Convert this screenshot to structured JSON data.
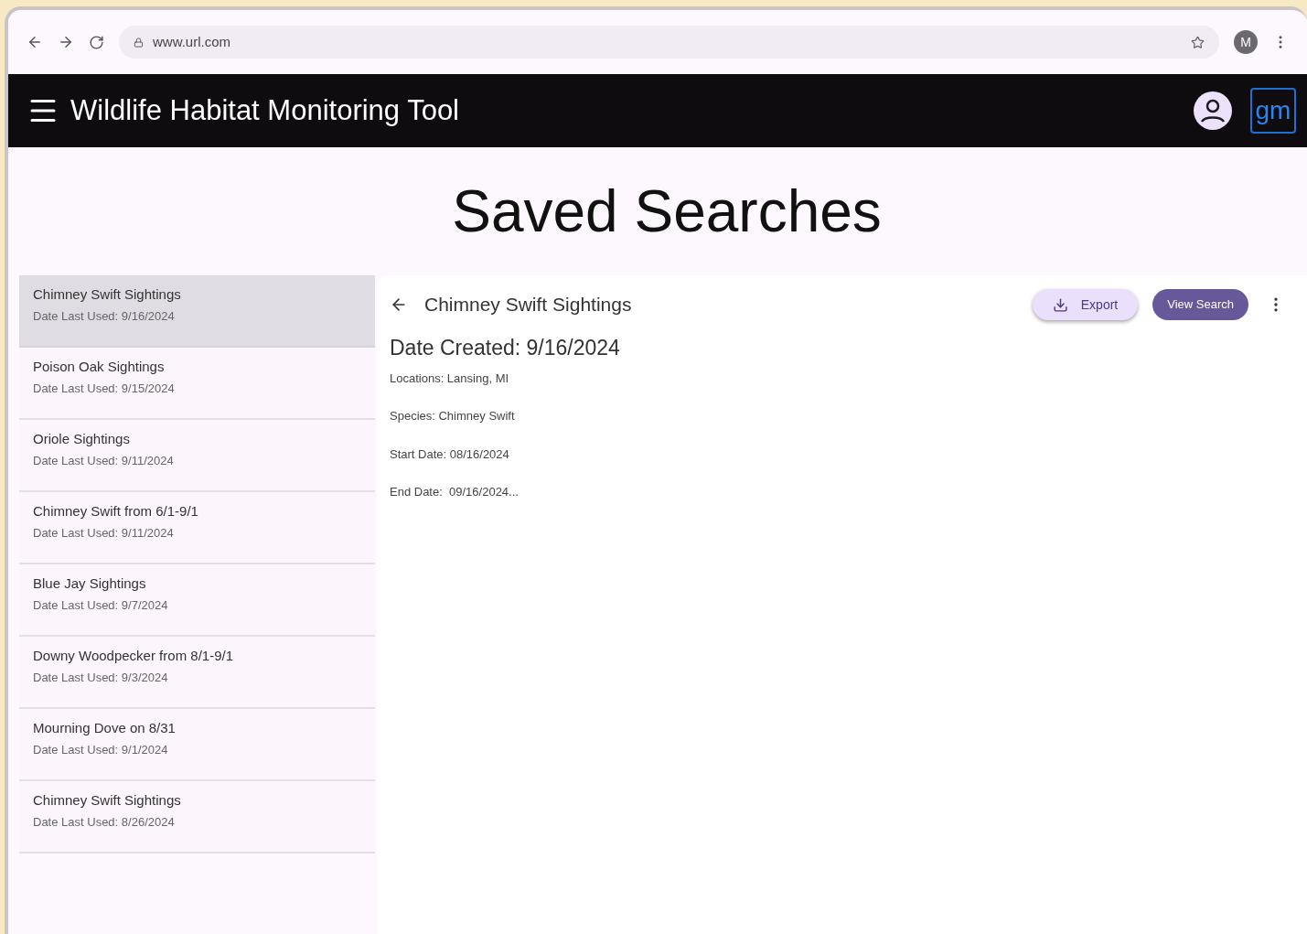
{
  "browser": {
    "url": "www.url.com",
    "profile_initial": "M"
  },
  "app_bar": {
    "title": "Wildlife Habitat Monitoring Tool",
    "logo_text": "gm"
  },
  "page_title": "Saved Searches",
  "saved_searches": [
    {
      "name": "Chimney Swift Sightings",
      "last_used": "Date Last Used: 9/16/2024",
      "selected": true
    },
    {
      "name": "Poison Oak Sightings",
      "last_used": "Date Last Used: 9/15/2024",
      "selected": false
    },
    {
      "name": "Oriole Sightings",
      "last_used": "Date Last Used: 9/11/2024",
      "selected": false
    },
    {
      "name": "Chimney Swift from 6/1-9/1",
      "last_used": "Date Last Used: 9/11/2024",
      "selected": false
    },
    {
      "name": "Blue Jay Sightings",
      "last_used": "Date Last Used: 9/7/2024",
      "selected": false
    },
    {
      "name": "Downy Woodpecker from 8/1-9/1",
      "last_used": "Date Last Used: 9/3/2024",
      "selected": false
    },
    {
      "name": "Mourning Dove on 8/31",
      "last_used": "Date Last Used: 9/1/2024",
      "selected": false
    },
    {
      "name": "Chimney Swift Sightings",
      "last_used": "Date Last Used: 8/26/2024",
      "selected": false
    }
  ],
  "detail": {
    "title": "Chimney Swift Sightings",
    "export_button": "Export",
    "view_button": "View Search",
    "date_created": "Date Created: 9/16/2024",
    "fields": [
      "Locations: Lansing, MI",
      "Species: Chimney Swift",
      "Start Date: 08/16/2024",
      "End Date:  09/16/2024..."
    ]
  }
}
